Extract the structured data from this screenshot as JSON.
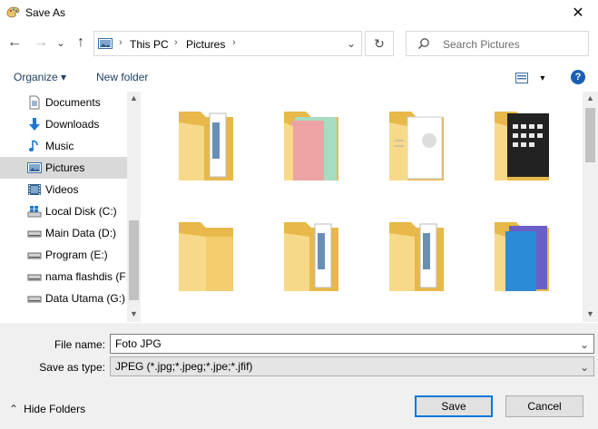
{
  "window": {
    "title": "Save As",
    "close_glyph": "✕"
  },
  "nav": {
    "back_glyph": "←",
    "forward_glyph": "→",
    "recent_glyph": "⌄",
    "up_glyph": "↑",
    "breadcrumbs": [
      "This PC",
      "Pictures"
    ],
    "crumb_separator": "›",
    "refresh_glyph": "↻",
    "search_placeholder": "Search Pictures"
  },
  "toolbar": {
    "organize_label": "Organize ▾",
    "new_folder_label": "New folder",
    "view_glyph": "▾",
    "help_glyph": "?"
  },
  "sidebar": {
    "items": [
      {
        "label": "Documents",
        "icon": "documents-icon"
      },
      {
        "label": "Downloads",
        "icon": "downloads-icon"
      },
      {
        "label": "Music",
        "icon": "music-icon"
      },
      {
        "label": "Pictures",
        "icon": "pictures-icon",
        "selected": true
      },
      {
        "label": "Videos",
        "icon": "videos-icon"
      },
      {
        "label": "Local Disk (C:)",
        "icon": "drive-icon"
      },
      {
        "label": "Main Data (D:)",
        "icon": "drive-icon"
      },
      {
        "label": "Program (E:)",
        "icon": "drive-icon"
      },
      {
        "label": "nama flashdis (F:",
        "icon": "drive-icon"
      },
      {
        "label": "Data Utama (G:)",
        "icon": "drive-icon"
      }
    ]
  },
  "folders": [
    {
      "icon": "folder-with-documents-icon"
    },
    {
      "icon": "folder-with-pink-green-icon"
    },
    {
      "icon": "folder-with-white-pages-icon"
    },
    {
      "icon": "folder-with-keyboard-photo-icon"
    },
    {
      "icon": "empty-folder-icon"
    },
    {
      "icon": "folder-with-documents-icon"
    },
    {
      "icon": "folder-with-documents-icon"
    },
    {
      "icon": "folder-with-blue-purple-icon"
    }
  ],
  "form": {
    "file_name_label": "File name:",
    "file_name_value": "Foto JPG",
    "save_type_label": "Save as type:",
    "save_type_value": "JPEG (*.jpg;*.jpeg;*.jpe;*.jfif)",
    "dropdown_glyph": "⌄"
  },
  "footer": {
    "hide_folders_label": "Hide Folders",
    "chevron_glyph": "⌃",
    "save_label": "Save",
    "cancel_label": "Cancel"
  },
  "colors": {
    "accent": "#0078d7",
    "folder": "#f4d27a",
    "selection": "#d9d9d9"
  }
}
